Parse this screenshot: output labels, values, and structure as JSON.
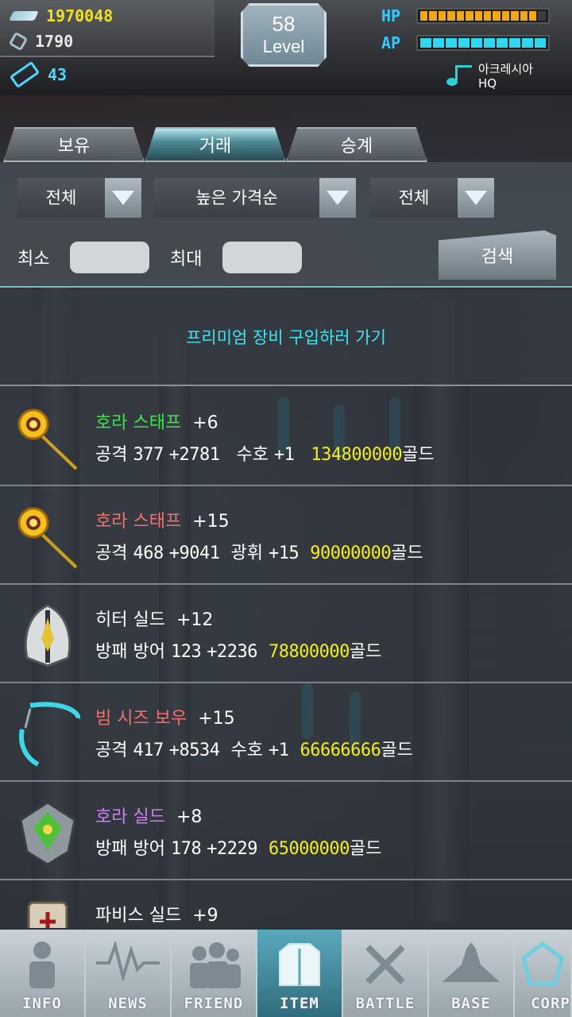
{
  "hud": {
    "gold": "1970048",
    "gems": "1790",
    "tickets": "43",
    "level_num": "58",
    "level_label": "Level",
    "hp_label": "HP",
    "ap_label": "AP",
    "hp_fraction": 0.9,
    "ap_fraction": 1.0,
    "location_line1": "아크레시아",
    "location_line2": "HQ",
    "colors": {
      "gold": "#f0e020",
      "tickets": "#4fd8ff",
      "hp": "#f0a81a",
      "ap": "#2fd8f0"
    }
  },
  "tabs": [
    {
      "label": "보유"
    },
    {
      "label": "거래"
    },
    {
      "label": "승계"
    }
  ],
  "filters": {
    "category": "전체",
    "sort": "높은 가격순",
    "type": "전체",
    "min_label": "최소",
    "max_label": "최대",
    "min_value": "",
    "max_value": "",
    "search_label": "검색"
  },
  "premium_link": "프리미엄 장비 구입하러 가기",
  "items": [
    {
      "name": "호라 스태프",
      "name_color": "#3fe24a",
      "plus": "+6",
      "stat_type": "공격",
      "stat_base": "377",
      "stat_bonus": "+2781",
      "enchant": "수호",
      "enchant_val": "+1",
      "price": "134800000",
      "currency": "골드",
      "icon": "staff-icon"
    },
    {
      "name": "호라 스태프",
      "name_color": "#f2706a",
      "plus": "+15",
      "stat_type": "공격",
      "stat_base": "468",
      "stat_bonus": "+9041",
      "enchant": "광휘",
      "enchant_val": "+15",
      "price": "90000000",
      "currency": "골드",
      "icon": "staff-icon"
    },
    {
      "name": "히터 실드",
      "name_color": "#ffffff",
      "plus": "+12",
      "stat_type": "방패 방어",
      "stat_base": "123",
      "stat_bonus": "+2236",
      "enchant": "",
      "enchant_val": "",
      "price": "78800000",
      "currency": "골드",
      "icon": "shield-icon"
    },
    {
      "name": "빔 시즈 보우",
      "name_color": "#f2706a",
      "plus": "+15",
      "stat_type": "공격",
      "stat_base": "417",
      "stat_bonus": "+8534",
      "enchant": "수호",
      "enchant_val": "+1",
      "price": "66666666",
      "currency": "골드",
      "icon": "bow-icon"
    },
    {
      "name": "호라 실드",
      "name_color": "#cf7ff0",
      "plus": "+8",
      "stat_type": "방패 방어",
      "stat_base": "178",
      "stat_bonus": "+2229",
      "enchant": "",
      "enchant_val": "",
      "price": "65000000",
      "currency": "골드",
      "icon": "emblem-shield-icon"
    },
    {
      "name": "파비스 실드",
      "name_color": "#ffffff",
      "plus": "+9",
      "stat_type": "",
      "stat_base": "",
      "stat_bonus": "",
      "enchant": "",
      "enchant_val": "",
      "price": "",
      "currency": "",
      "icon": "pavise-shield-icon"
    }
  ],
  "nav": [
    {
      "label": "INFO",
      "icon": "person-icon"
    },
    {
      "label": "NEWS",
      "icon": "pulse-icon"
    },
    {
      "label": "FRIEND",
      "icon": "friends-icon"
    },
    {
      "label": "ITEM",
      "icon": "item-icon",
      "active": true
    },
    {
      "label": "BATTLE",
      "icon": "swords-icon"
    },
    {
      "label": "BASE",
      "icon": "base-icon"
    },
    {
      "label": "CORP",
      "icon": "corp-icon"
    }
  ]
}
